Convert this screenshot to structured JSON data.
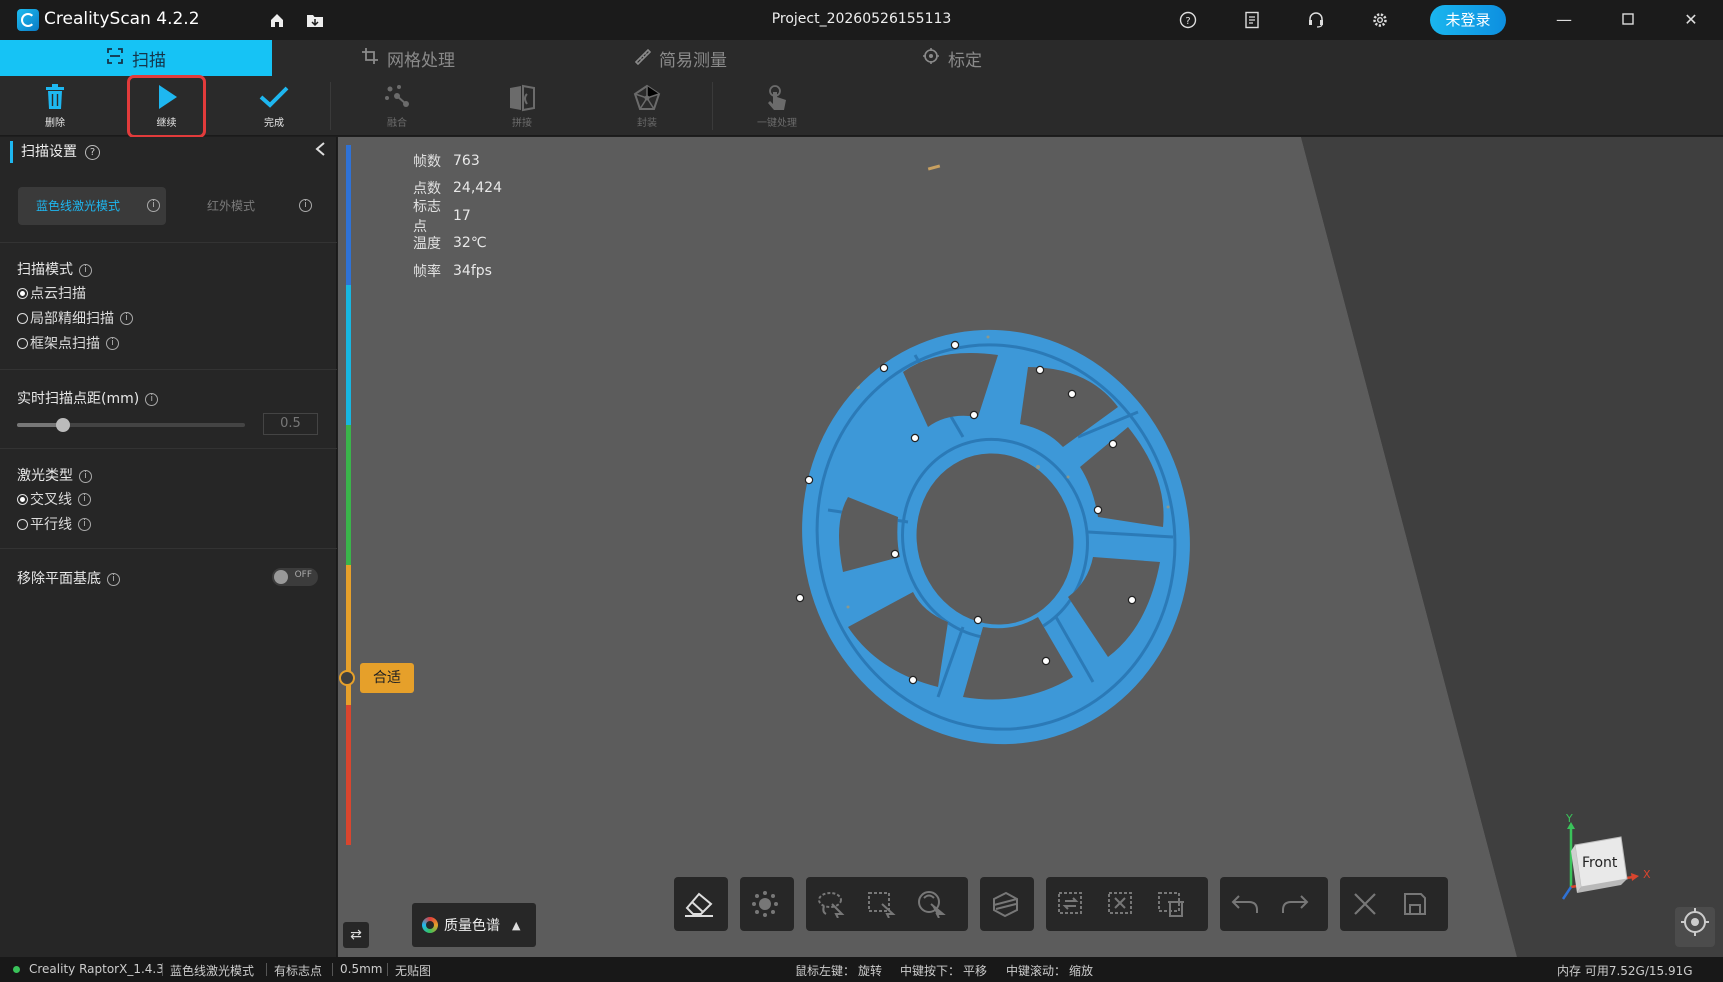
{
  "app": {
    "title": "CrealityScan 4.2.2",
    "project": "Project_20260526155113",
    "login_label": "未登录"
  },
  "tabs": [
    {
      "label": "扫描",
      "icon": "scan-frame-icon",
      "active": true
    },
    {
      "label": "网格处理",
      "icon": "crop-icon",
      "active": false
    },
    {
      "label": "简易测量",
      "icon": "ruler-icon",
      "active": false
    },
    {
      "label": "标定",
      "icon": "crosshair-icon",
      "active": false
    }
  ],
  "toolbar": {
    "delete": "删除",
    "continue": "继续",
    "finish": "完成",
    "fuse": "融合",
    "stitch": "拼接",
    "encapsulate": "封装",
    "one_click": "一键处理"
  },
  "panel": {
    "title": "扫描设置",
    "mode_blue": "蓝色线激光模式",
    "mode_ir": "红外模式",
    "scan_mode_title": "扫描模式",
    "scan_modes": [
      "点云扫描",
      "局部精细扫描",
      "框架点扫描"
    ],
    "scan_mode_selected": 0,
    "point_distance_title": "实时扫描点距(mm)",
    "point_distance_value": "0.5",
    "slider_fraction": 0.2,
    "laser_type_title": "激光类型",
    "laser_types": [
      "交叉线",
      "平行线"
    ],
    "laser_selected": 0,
    "remove_plane_title": "移除平面基底",
    "remove_plane_state": "OFF"
  },
  "stats": {
    "frames_label": "帧数",
    "frames": "763",
    "points_label": "点数",
    "points": "24,424",
    "markers_label": "标志点",
    "markers": "17",
    "temp_label": "温度",
    "temp": "32℃",
    "fps_label": "帧率",
    "fps": "34fps"
  },
  "viewport": {
    "quality_label": "合适",
    "quality_colormap_label": "质量色谱",
    "view_cube_face": "Front",
    "axis_x": "X",
    "axis_y": "Y"
  },
  "statusbar": {
    "device": "Creality RaptorX_1.4.3",
    "mode": "蓝色线激光模式",
    "markers": "有标志点",
    "distance": "0.5mm",
    "texture": "无贴图",
    "hint_left_key": "鼠标左键：",
    "hint_left_val": "旋转",
    "hint_mid_key": "中键按下：",
    "hint_mid_val": "平移",
    "hint_scroll_key": "中键滚动：",
    "hint_scroll_val": "缩放",
    "memory": "内存 可用7.52G/15.91G"
  },
  "colors": {
    "accent": "#16c3f5",
    "quality_blue": "#2f72d6",
    "quality_cyan": "#18b6e0",
    "quality_green": "#3ab44a",
    "quality_orange": "#e6a02a",
    "quality_red": "#d9452e",
    "scan_blue": "#3d98d8",
    "highlight_red": "#e23b3b"
  }
}
